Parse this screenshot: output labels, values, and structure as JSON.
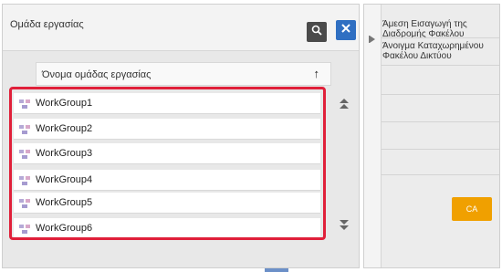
{
  "panel": {
    "title": "Ομάδα εργασίας",
    "sort_label": "Όνομα ομάδας εργασίας",
    "sort_arrow": "↑",
    "search_icon": "search-icon",
    "close_icon": "close-icon"
  },
  "list": {
    "items": [
      {
        "label": "WorkGroup1"
      },
      {
        "label": "WorkGroup2"
      },
      {
        "label": "WorkGroup3"
      },
      {
        "label": "WorkGroup4"
      },
      {
        "label": "WorkGroup5"
      },
      {
        "label": "WorkGroup6"
      }
    ],
    "scroll_up_icon": "double-chevron-up-icon",
    "scroll_down_icon": "double-chevron-down-icon"
  },
  "side": {
    "item1": "Άμεση Εισαγωγή της Διαδρομής Φακέλου",
    "item2": "Άνοιγμα Καταχωρημένου Φακέλου Δικτύου",
    "ca_label": "CA"
  },
  "colors": {
    "accent_blue": "#2f6fc2",
    "highlight_red": "#e0203a",
    "ca_orange": "#f0a000"
  }
}
